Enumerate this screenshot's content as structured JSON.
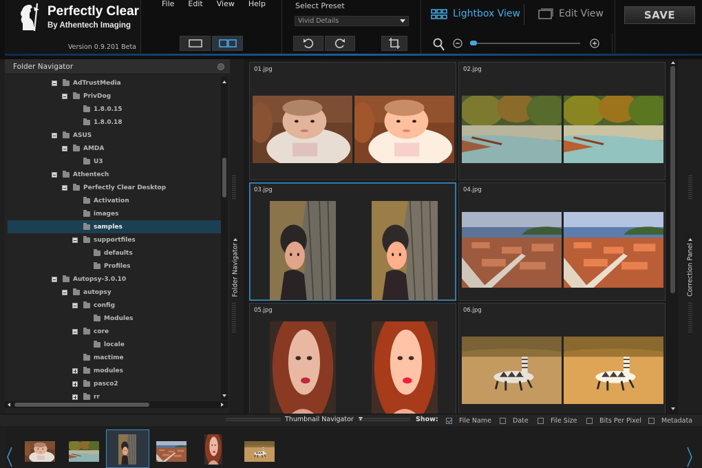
{
  "app": {
    "name": "Perfectly Clear",
    "subtitle": "By Athentech Imaging",
    "version": "Version 0.9.201 Beta"
  },
  "menu": [
    "File",
    "Edit",
    "View",
    "Help"
  ],
  "preset": {
    "label": "Select Preset",
    "value": "Vivid Details"
  },
  "views": {
    "lightbox": "Lightbox View",
    "edit": "Edit View"
  },
  "save_label": "SAVE",
  "folder_navigator": {
    "title": "Folder Navigator",
    "tab_label": "Folder Navigator",
    "tree": [
      {
        "label": "AdTrustMedia",
        "level": 0,
        "expander": "minus"
      },
      {
        "label": "PrivDog",
        "level": 1,
        "expander": "minus"
      },
      {
        "label": "1.8.0.15",
        "level": 2,
        "expander": ""
      },
      {
        "label": "1.8.0.18",
        "level": 2,
        "expander": ""
      },
      {
        "label": "ASUS",
        "level": 0,
        "expander": "minus"
      },
      {
        "label": "AMDA",
        "level": 1,
        "expander": "minus"
      },
      {
        "label": "U3",
        "level": 2,
        "expander": ""
      },
      {
        "label": "Athentech",
        "level": 0,
        "expander": "minus"
      },
      {
        "label": "Perfectly Clear Desktop",
        "level": 1,
        "expander": "minus"
      },
      {
        "label": "Activation",
        "level": 2,
        "expander": ""
      },
      {
        "label": "images",
        "level": 2,
        "expander": ""
      },
      {
        "label": "samples",
        "level": 2,
        "expander": "",
        "selected": true
      },
      {
        "label": "supportfiles",
        "level": 2,
        "expander": "minus"
      },
      {
        "label": "defaults",
        "level": 3,
        "expander": ""
      },
      {
        "label": "Profiles",
        "level": 3,
        "expander": ""
      },
      {
        "label": "Autopsy-3.0.10",
        "level": 0,
        "expander": "minus"
      },
      {
        "label": "autopsy",
        "level": 1,
        "expander": "minus"
      },
      {
        "label": "config",
        "level": 2,
        "expander": "minus"
      },
      {
        "label": "Modules",
        "level": 3,
        "expander": ""
      },
      {
        "label": "core",
        "level": 2,
        "expander": "minus"
      },
      {
        "label": "locale",
        "level": 3,
        "expander": ""
      },
      {
        "label": "mactime",
        "level": 2,
        "expander": ""
      },
      {
        "label": "modules",
        "level": 2,
        "expander": "plus"
      },
      {
        "label": "pasco2",
        "level": 2,
        "expander": "plus"
      },
      {
        "label": "rr",
        "level": 2,
        "expander": "plus"
      }
    ]
  },
  "correction_panel_label": "Correction Panel",
  "images": [
    {
      "name": "01.jpg",
      "subject": "baby",
      "selected": false
    },
    {
      "name": "02.jpg",
      "subject": "river",
      "selected": false
    },
    {
      "name": "03.jpg",
      "subject": "child-tree",
      "selected": true
    },
    {
      "name": "04.jpg",
      "subject": "town",
      "selected": false
    },
    {
      "name": "05.jpg",
      "subject": "woman",
      "selected": false
    },
    {
      "name": "06.jpg",
      "subject": "zebra",
      "selected": false
    }
  ],
  "bottom": {
    "thumbnail_navigator": "Thumbnail Navigator",
    "show_label": "Show:",
    "options": [
      {
        "label": "File Name",
        "checked": true
      },
      {
        "label": "Date",
        "checked": false
      },
      {
        "label": "File Size",
        "checked": false
      },
      {
        "label": "Bits Per Pixel",
        "checked": false
      },
      {
        "label": "Metadata",
        "checked": false
      }
    ]
  },
  "filmstrip": [
    "baby",
    "river",
    "child-tree",
    "town",
    "woman",
    "zebra"
  ],
  "colors": {
    "accent": "#46b0ea",
    "selection": "#3c8fc2",
    "tree_selected": "#1c4053"
  }
}
